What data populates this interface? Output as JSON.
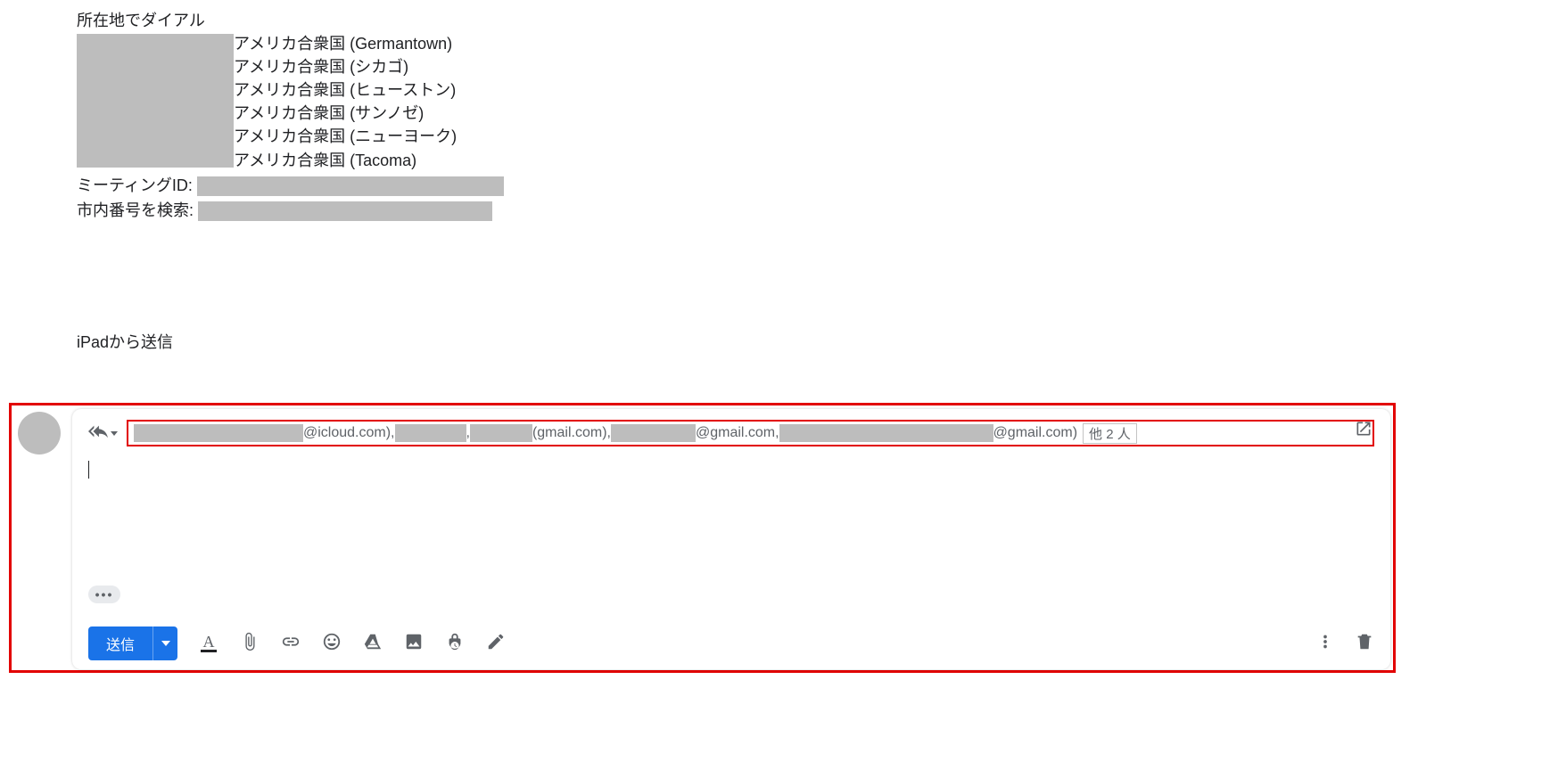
{
  "body": {
    "dial_heading": "所在地でダイアル",
    "locations": [
      "アメリカ合衆国 (Germantown)",
      "アメリカ合衆国 (シカゴ)",
      "アメリカ合衆国 (ヒューストン)",
      "アメリカ合衆国 (サンノゼ)",
      "アメリカ合衆国 (ニューヨーク)",
      "アメリカ合衆国 (Tacoma)"
    ],
    "meeting_id_label": "ミーティングID:",
    "find_local_label": "市内番号を検索:",
    "signature": "iPadから送信"
  },
  "compose": {
    "recipients": {
      "seg1": "@icloud.com),",
      "seg2": ",",
      "seg3": "(gmail.com),",
      "seg4": "@gmail.com,",
      "seg5": "@gmail.com)",
      "others": "他 2 人"
    },
    "send_label": "送信",
    "trimmed_content_label": "•••"
  },
  "icons": {
    "reply_all": "reply-all-icon",
    "popout": "popout-icon",
    "format": "format-text-icon",
    "attach": "paperclip-icon",
    "link": "link-icon",
    "emoji": "emoji-icon",
    "drive": "drive-icon",
    "photo": "photo-icon",
    "confidential": "lock-clock-icon",
    "pen": "pen-icon",
    "more": "more-vert-icon",
    "trash": "trash-icon"
  }
}
